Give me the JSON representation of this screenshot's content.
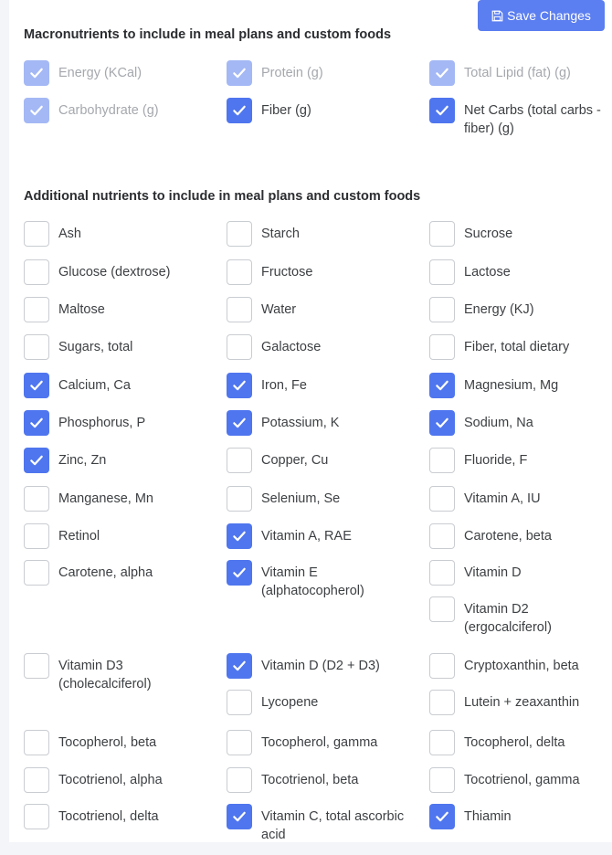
{
  "toolbar": {
    "save_label": "Save Changes"
  },
  "macro": {
    "heading": "Macronutrients to include in meal plans and custom foods",
    "rows": [
      [
        {
          "label": "Energy (KCal)",
          "state": "disabled"
        },
        {
          "label": "Protein (g)",
          "state": "disabled"
        },
        {
          "label": "Total Lipid (fat) (g)",
          "state": "disabled"
        }
      ],
      [
        {
          "label": "Carbohydrate (g)",
          "state": "disabled"
        },
        {
          "label": "Fiber (g)",
          "state": "on"
        },
        {
          "label": "Net Carbs (total carbs - fiber) (g)",
          "state": "on"
        }
      ]
    ]
  },
  "additional": {
    "heading": "Additional nutrients to include in meal plans and custom foods",
    "rows": [
      [
        [
          {
            "label": "Ash",
            "state": "off"
          }
        ],
        [
          {
            "label": "Starch",
            "state": "off"
          }
        ],
        [
          {
            "label": "Sucrose",
            "state": "off"
          }
        ]
      ],
      [
        [
          {
            "label": "Glucose (dextrose)",
            "state": "off"
          }
        ],
        [
          {
            "label": "Fructose",
            "state": "off"
          }
        ],
        [
          {
            "label": "Lactose",
            "state": "off"
          }
        ]
      ],
      [
        [
          {
            "label": "Maltose",
            "state": "off"
          }
        ],
        [
          {
            "label": "Water",
            "state": "off"
          }
        ],
        [
          {
            "label": "Energy (KJ)",
            "state": "off"
          }
        ]
      ],
      [
        [
          {
            "label": "Sugars, total",
            "state": "off"
          }
        ],
        [
          {
            "label": "Galactose",
            "state": "off"
          }
        ],
        [
          {
            "label": "Fiber, total dietary",
            "state": "off"
          }
        ]
      ],
      [
        [
          {
            "label": "Calcium, Ca",
            "state": "on"
          }
        ],
        [
          {
            "label": "Iron, Fe",
            "state": "on"
          }
        ],
        [
          {
            "label": "Magnesium, Mg",
            "state": "on"
          }
        ]
      ],
      [
        [
          {
            "label": "Phosphorus, P",
            "state": "on"
          }
        ],
        [
          {
            "label": "Potassium, K",
            "state": "on"
          }
        ],
        [
          {
            "label": "Sodium, Na",
            "state": "on"
          }
        ]
      ],
      [
        [
          {
            "label": "Zinc, Zn",
            "state": "on"
          }
        ],
        [
          {
            "label": "Copper, Cu",
            "state": "off"
          }
        ],
        [
          {
            "label": "Fluoride, F",
            "state": "off"
          }
        ]
      ],
      [
        [
          {
            "label": "Manganese, Mn",
            "state": "off"
          }
        ],
        [
          {
            "label": "Selenium, Se",
            "state": "off"
          }
        ],
        [
          {
            "label": "Vitamin A, IU",
            "state": "off"
          }
        ]
      ],
      [
        [
          {
            "label": "Retinol",
            "state": "off"
          }
        ],
        [
          {
            "label": "Vitamin A, RAE",
            "state": "on"
          }
        ],
        [
          {
            "label": "Carotene, beta",
            "state": "off"
          }
        ]
      ],
      [
        [
          {
            "label": "Carotene, alpha",
            "state": "off"
          }
        ],
        [
          {
            "label": "Vitamin E (alphatocopherol)",
            "state": "on"
          }
        ],
        [
          {
            "label": "Vitamin D",
            "state": "off"
          },
          {
            "label": "Vitamin D2 (ergocalciferol)",
            "state": "off"
          }
        ]
      ],
      [
        [
          {
            "label": "Vitamin D3 (cholecalciferol)",
            "state": "off"
          }
        ],
        [
          {
            "label": "Vitamin D (D2 + D3)",
            "state": "on"
          },
          {
            "label": "Lycopene",
            "state": "off"
          }
        ],
        [
          {
            "label": "Cryptoxanthin, beta",
            "state": "off"
          },
          {
            "label": "Lutein + zeaxanthin",
            "state": "off"
          }
        ]
      ],
      [
        [
          {
            "label": "Tocopherol, beta",
            "state": "off"
          }
        ],
        [
          {
            "label": "Tocopherol, gamma",
            "state": "off"
          }
        ],
        [
          {
            "label": "Tocopherol, delta",
            "state": "off"
          }
        ]
      ],
      [
        [
          {
            "label": "Tocotrienol, alpha",
            "state": "off"
          }
        ],
        [
          {
            "label": "Tocotrienol, beta",
            "state": "off"
          }
        ],
        [
          {
            "label": "Tocotrienol, gamma",
            "state": "off"
          }
        ]
      ],
      [
        [
          {
            "label": "Tocotrienol, delta",
            "state": "off"
          }
        ],
        [
          {
            "label": "Vitamin C, total ascorbic acid",
            "state": "on"
          }
        ],
        [
          {
            "label": "Thiamin",
            "state": "on"
          }
        ]
      ]
    ]
  },
  "colors": {
    "accent": "#4f76ee",
    "accent_disabled": "#a4b8f5",
    "button": "#5b7ef0"
  }
}
